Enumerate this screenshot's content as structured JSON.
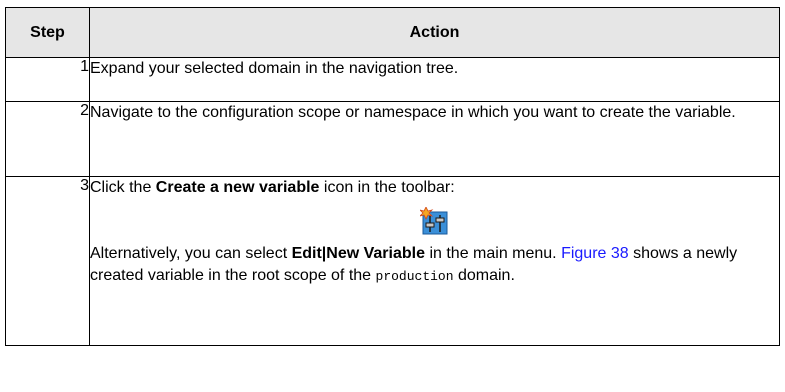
{
  "table": {
    "headers": {
      "step": "Step",
      "action": "Action"
    },
    "rows": [
      {
        "step": "1",
        "text": "Expand your selected domain in the navigation tree."
      },
      {
        "step": "2",
        "text": "Navigate to the configuration scope or namespace in which you want to create the variable."
      },
      {
        "step": "3",
        "line1_prefix": "Click the ",
        "line1_bold": "Create a new variable",
        "line1_suffix": " icon in the toolbar:",
        "icon": "create-variable-icon",
        "alt_prefix": "Alternatively, you can select ",
        "alt_bold": "Edit|New Variable",
        "alt_mid": " in the main menu. ",
        "alt_link": "Figure 38",
        "alt_after_link": " shows a newly created variable in the root scope of the ",
        "alt_code": "production",
        "alt_end": " domain."
      }
    ]
  },
  "colors": {
    "header_bg": "#e6e6e6",
    "link": "#1a1aff",
    "icon_bg": "#3a8fd8",
    "icon_star": "#f5a623"
  }
}
